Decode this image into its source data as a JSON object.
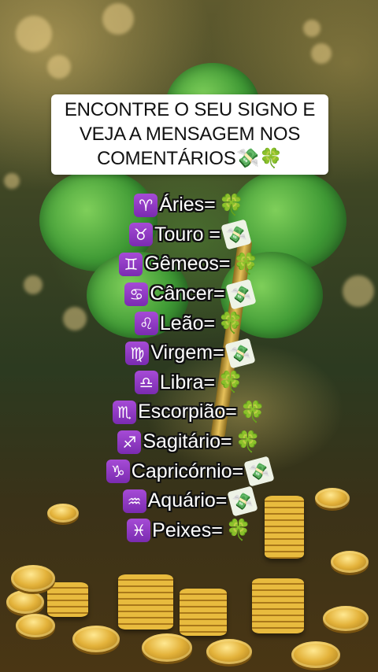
{
  "headline": {
    "lines": [
      "ENCONTRE O SEU SIGNO E",
      "VEJA A MENSAGEM NOS",
      "COMENTÁRIOS"
    ],
    "trailing_icons": [
      "💸",
      "🍀"
    ]
  },
  "signs": [
    {
      "glyph": "♈",
      "text": "Áries=",
      "outcome": "🍀",
      "outcome_icon": "four-leaf-clover-icon"
    },
    {
      "glyph": "♉",
      "text": "Touro =",
      "outcome": "💸",
      "outcome_icon": "money-with-wings-icon"
    },
    {
      "glyph": "♊",
      "text": "Gêmeos=",
      "outcome": "🍀",
      "outcome_icon": "four-leaf-clover-icon"
    },
    {
      "glyph": "♋",
      "text": "Câncer=",
      "outcome": "💸",
      "outcome_icon": "money-with-wings-icon"
    },
    {
      "glyph": "♌",
      "text": "Leão=",
      "outcome": "🍀",
      "outcome_icon": "four-leaf-clover-icon"
    },
    {
      "glyph": "♍",
      "text": "Virgem=",
      "outcome": "💸",
      "outcome_icon": "money-with-wings-icon"
    },
    {
      "glyph": "♎",
      "text": "Libra=",
      "outcome": "🍀",
      "outcome_icon": "four-leaf-clover-icon"
    },
    {
      "glyph": "♏",
      "text": "Escorpião=",
      "outcome": "🍀",
      "outcome_icon": "four-leaf-clover-icon"
    },
    {
      "glyph": "♐",
      "text": "Sagitário=",
      "outcome": "🍀",
      "outcome_icon": "four-leaf-clover-icon"
    },
    {
      "glyph": "♑",
      "text": "Capricórnio=",
      "outcome": "💸",
      "outcome_icon": "money-with-wings-icon"
    },
    {
      "glyph": "♒",
      "text": "Aquário=",
      "outcome": "💸",
      "outcome_icon": "money-with-wings-icon"
    },
    {
      "glyph": "♓",
      "text": "Peixes=",
      "outcome": "🍀",
      "outcome_icon": "four-leaf-clover-icon"
    }
  ],
  "colors": {
    "text_fill": "#ffffff",
    "text_outline": "#111111",
    "zodiac_badge": "#8e3bc4",
    "clover": "#3fbf3a",
    "headline_bg": "#ffffff"
  }
}
